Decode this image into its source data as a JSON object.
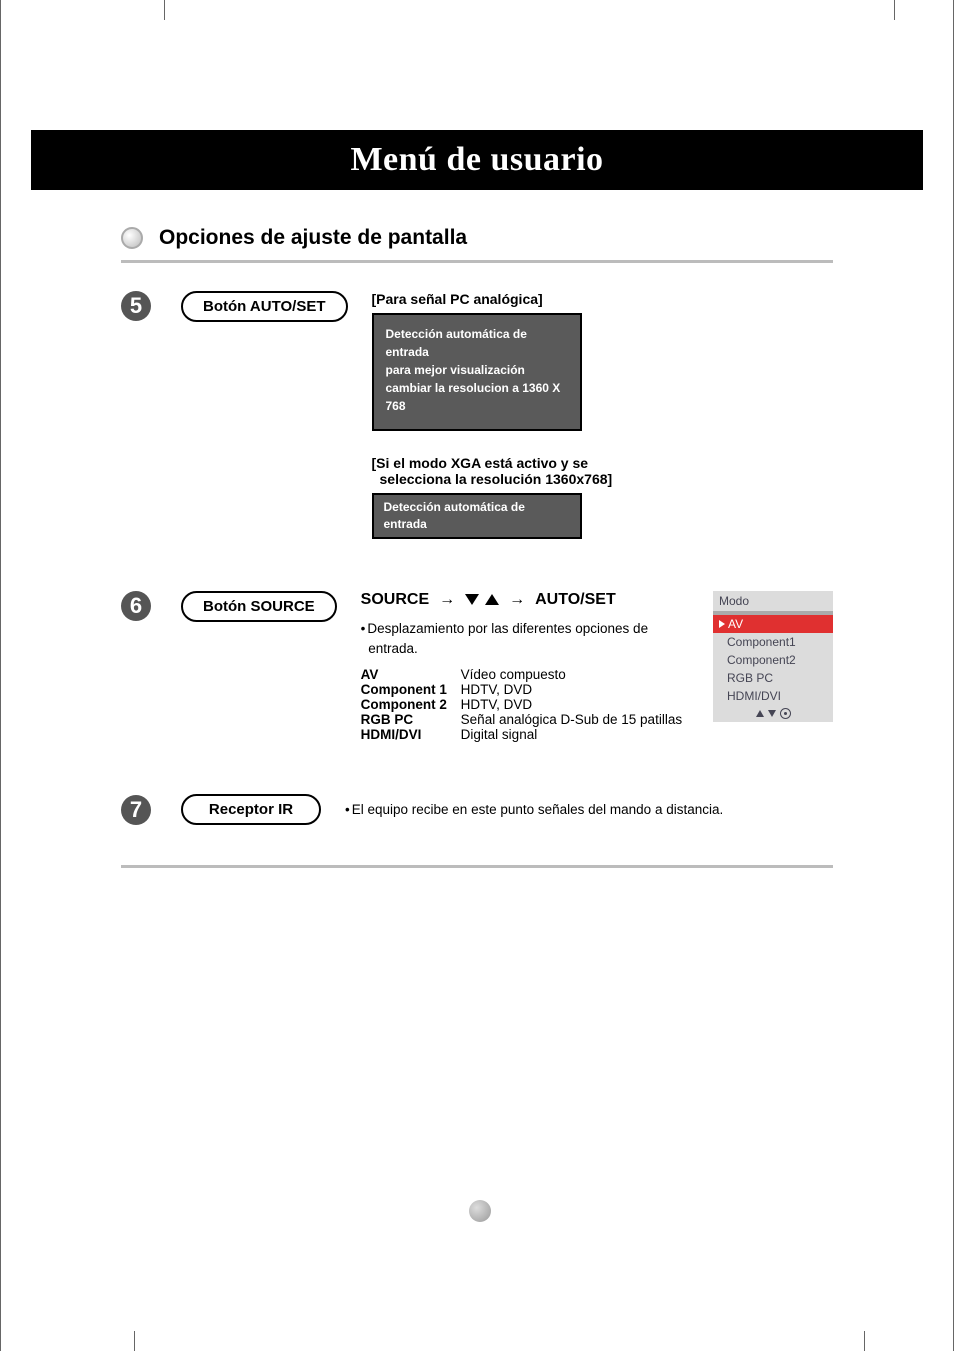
{
  "title": "Menú de usuario",
  "section_heading": "Opciones de ajuste de pantalla",
  "step5": {
    "num": "5",
    "button": "Botón AUTO/SET",
    "h1": "[Para señal PC analógica]",
    "osd1_l1": "Detección automática de entrada",
    "osd1_l2": "para mejor visualización",
    "osd1_l3": "cambiar la resolucion a 1360 X 768",
    "h2a": "[Si el modo XGA está activo y se",
    "h2b": "selecciona la resolución 1360x768]",
    "osd2": "Detección automática de entrada"
  },
  "step6": {
    "num": "6",
    "button": "Botón SOURCE",
    "flow_a": "SOURCE",
    "flow_b": "AUTO/SET",
    "desc1": "Desplazamiento por las diferentes opciones de",
    "desc2": "entrada.",
    "rows": [
      {
        "a": "AV",
        "b": "Vídeo compuesto"
      },
      {
        "a": "Component 1",
        "b": "HDTV, DVD"
      },
      {
        "a": "Component 2",
        "b": "HDTV, DVD"
      },
      {
        "a": "RGB PC",
        "b": "Señal analógica D-Sub de 15 patillas"
      },
      {
        "a": "HDMI/DVI",
        "b": "Digital signal"
      }
    ],
    "modo": {
      "title": "Modo",
      "sel": "AV",
      "items": [
        "Component1",
        "Component2",
        "RGB PC",
        "HDMI/DVI"
      ]
    }
  },
  "step7": {
    "num": "7",
    "button": "Receptor IR",
    "text": "El equipo recibe en este punto señales del mando a distancia."
  }
}
